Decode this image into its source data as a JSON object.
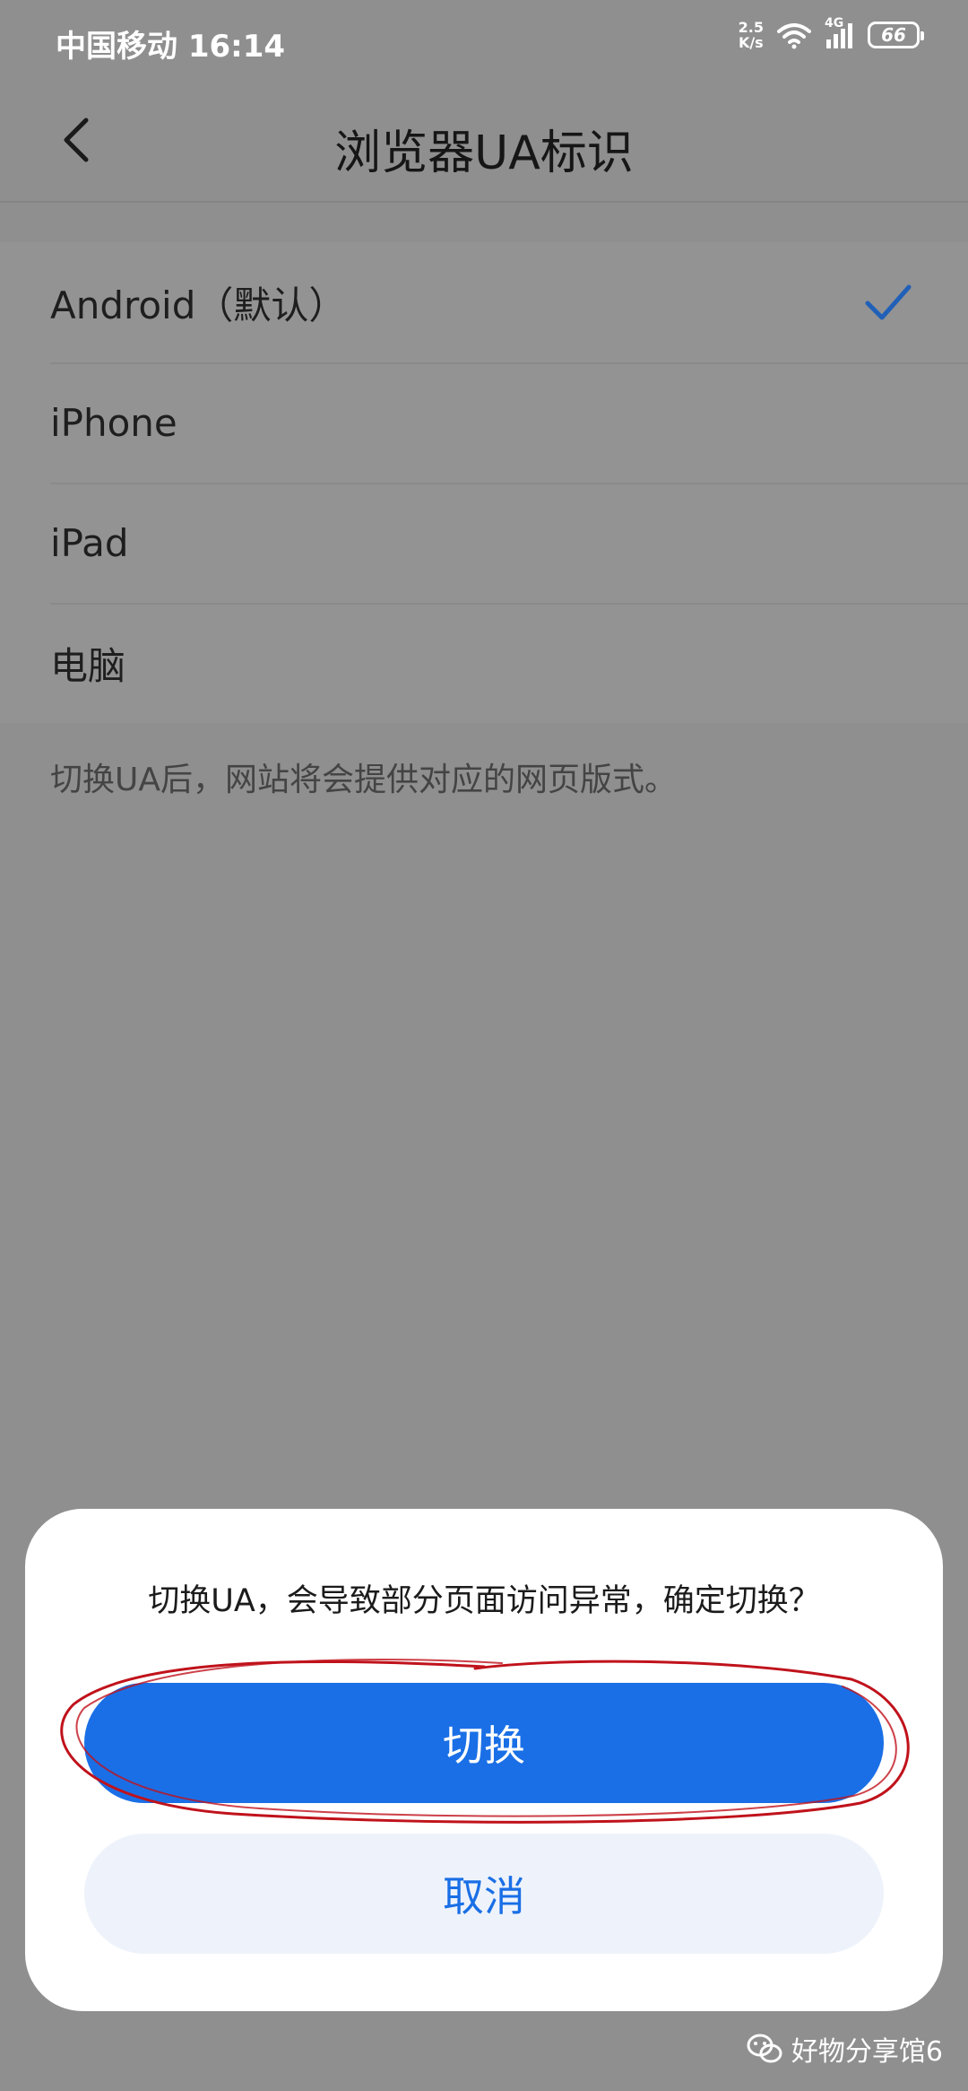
{
  "status_bar": {
    "carrier_time": "中国移动 16:14",
    "net_speed_value": "2.5",
    "net_speed_unit": "K/s",
    "network_type": "4G",
    "battery": "66"
  },
  "header": {
    "title": "浏览器UA标识",
    "back_icon": "chevron-left-icon"
  },
  "ua_options": [
    {
      "label": "Android（默认）",
      "selected": true
    },
    {
      "label": "iPhone",
      "selected": false
    },
    {
      "label": "iPad",
      "selected": false
    },
    {
      "label": "电脑",
      "selected": false
    }
  ],
  "hint": "切换UA后，网站将会提供对应的网页版式。",
  "dialog": {
    "message": "切换UA，会导致部分页面访问异常，确定切换？",
    "confirm_label": "切换",
    "cancel_label": "取消"
  },
  "watermark": {
    "text": "好物分享馆6",
    "icon": "wechat-icon"
  },
  "colors": {
    "accent": "#1a6fe6",
    "annotation": "#c0121b",
    "overlay_bg": "#8f8f8f"
  }
}
